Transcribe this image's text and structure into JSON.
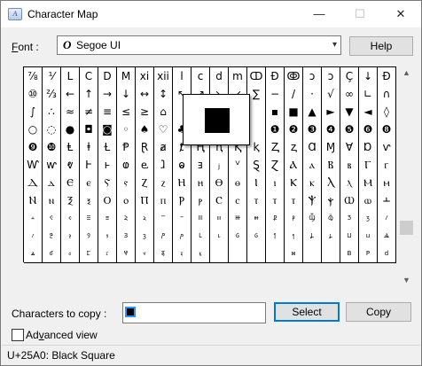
{
  "window": {
    "title": "Character Map",
    "minimize": "—",
    "maximize": "☐",
    "close": "✕"
  },
  "font": {
    "label_before": "",
    "label_accel": "F",
    "label_after": "ont :",
    "value": "Segoe UI",
    "icon_glyph": "O",
    "dropdown": "▾"
  },
  "help_button": "Help",
  "grid": {
    "rows": [
      [
        "⅞",
        "⅟",
        "L",
        "C",
        "D",
        "M",
        "xi",
        "xii",
        "l",
        "c",
        "d",
        "m",
        "ↀ",
        "Ɖ",
        "ↂ",
        "ↄ",
        "ↄ",
        "Ç",
        "↓",
        "Ɖ"
      ],
      [
        "⑩",
        "⅔",
        "←",
        "↑",
        "→",
        "↓",
        "↔",
        "↕",
        "↖",
        "↗",
        "↘",
        "↙",
        "∑",
        "−",
        "/",
        "·",
        "√",
        "∞",
        "∟",
        "∩"
      ],
      [
        "∫",
        "∴",
        "≈",
        "≠",
        "≡",
        "≤",
        "≥",
        "⌂",
        "",
        "",
        "",
        "",
        "",
        "▪",
        "■",
        "▲",
        "►",
        "▼",
        "◄",
        "◊"
      ],
      [
        "○",
        "◌",
        "●",
        "◘",
        "◙",
        "◦",
        "♠",
        "♡",
        "♣",
        "",
        "",
        "",
        "",
        "❶",
        "❷",
        "❸",
        "❹",
        "❺",
        "❻",
        "❽"
      ],
      [
        "❾",
        "❿",
        "Ⱡ",
        "ⱡ",
        "Ɫ",
        "Ᵽ",
        "Ɽ",
        "ⱥ",
        "ⱦ",
        "Ⱨ",
        "ⱨ",
        "Ⱪ",
        "ⱪ",
        "Ⱬ",
        "ⱬ",
        "Ɑ",
        "Ɱ",
        "Ɐ",
        "Ɒ",
        "ⱱ"
      ],
      [
        "Ⱳ",
        "ⱳ",
        "ⱴ",
        "Ⱶ",
        "ⱶ",
        "ⱷ",
        "ⱸ",
        "ⱹ",
        "ⱺ",
        "ⱻ",
        "ⱼ",
        "ⱽ",
        "Ȿ",
        "Ɀ",
        "Ⲁ",
        "ⲁ",
        "Ⲃ",
        "ⲃ",
        "Ⲅ",
        "ⲅ"
      ],
      [
        "Ⲇ",
        "ⲇ",
        "Ⲉ",
        "ⲉ",
        "Ⲋ",
        "ⲋ",
        "Ⲍ",
        "ⲍ",
        "Ⲏ",
        "ⲏ",
        "Ⲑ",
        "ⲑ",
        "Ⲓ",
        "ⲓ",
        "Ⲕ",
        "ⲕ",
        "Ⲗ",
        "ⲗ",
        "Ⲙ",
        "ⲙ"
      ],
      [
        "Ⲛ",
        "ⲛ",
        "Ⲝ",
        "ⲝ",
        "Ⲟ",
        "ⲟ",
        "Ⲡ",
        "ⲡ",
        "Ⲣ",
        "ⲣ",
        "Ⲥ",
        "ⲥ",
        "ⲧ",
        "ⲧ",
        "ⲧ",
        "Ⲯ",
        "ⲯ",
        "Ⲱ",
        "ⲱ",
        "Ⲳ"
      ],
      [
        "ⲳ",
        "Ⲵ",
        "ⲵ",
        "Ⲷ",
        "ⲷ",
        "Ⲹ",
        "ⲹ",
        "Ⲻ",
        "ⲻ",
        "Ⲽ",
        "ⲽ",
        "Ⲿ",
        "ⲿ",
        "Ⳁ",
        "ⳁ",
        "Ⳃ",
        "ⳃ",
        "Ⳅ",
        "ⳅ",
        "Ⳇ"
      ],
      [
        "ⳇ",
        "Ⳉ",
        "ⳉ",
        "Ⳋ",
        "ⳋ",
        "Ⳍ",
        "ⳍ",
        "Ⳏ",
        "ⳏ",
        "Ⳑ",
        "ⳑ",
        "Ⳓ",
        "ⳓ",
        "Ⳕ",
        "ⳕ",
        "Ⳗ",
        "ⳗ",
        "Ⳙ",
        "ⳙ",
        "Ⳛ"
      ],
      [
        "ⳛ",
        "Ⳝ",
        "ⳝ",
        "Ⳟ",
        "ⳟ",
        "Ⳡ",
        "ⳡ",
        "Ⳣ",
        "ⳣ",
        "ⳤ",
        "",
        "",
        "",
        "",
        "ⳮ",
        "",
        "",
        "B",
        "P",
        "d"
      ]
    ]
  },
  "zoom_preview": {
    "char": "■"
  },
  "chars_to_copy": {
    "label": "Characters to copy :",
    "value": "■"
  },
  "select_button": "Select",
  "copy_button": "Copy",
  "advanced_view": {
    "label_before": "Ad",
    "label_accel": "v",
    "label_after": "anced view",
    "checked": false
  },
  "status_text": "U+25A0: Black Square",
  "scrollbar": {
    "up": "▲",
    "down": "▼"
  }
}
